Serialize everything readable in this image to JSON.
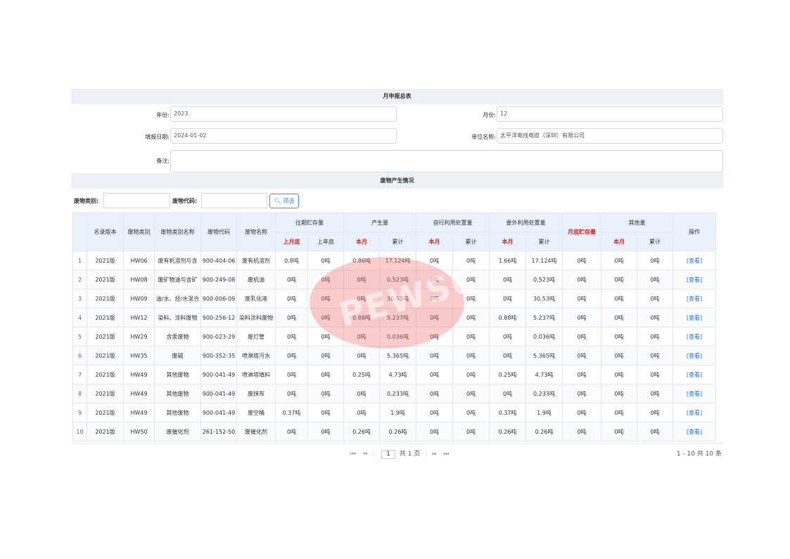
{
  "report": {
    "title": "月申报总表",
    "year_label": "年份:",
    "year_value": "2023",
    "month_label": "月份:",
    "month_value": "12",
    "fill_date_label": "填报日期:",
    "fill_date_value": "2024-01-02",
    "company_label": "单位名称:",
    "company_value": "太平洋电线电缆（深圳）有限公司",
    "remark_label": "备注:",
    "remark_value": ""
  },
  "waste_section": {
    "title": "废物产生情况",
    "filter_category_label": "废物类别:",
    "filter_code_label": "废物代码:",
    "filter_button": "筛选",
    "filter_icon": "search-icon"
  },
  "table": {
    "headers": {
      "version": "名录版本",
      "category": "废物类别",
      "category_name": "废物类别名称",
      "code": "废物代码",
      "name": "废物名称",
      "past_storage": "往期贮存量",
      "past_last_month": "上月底",
      "past_last_year": "上年底",
      "produced": "产生量",
      "produced_month": "本月",
      "produced_total": "累计",
      "self_use": "自行利用处置量",
      "self_month": "本月",
      "self_total": "累计",
      "outsource": "委外利用处置量",
      "out_month": "本月",
      "out_total": "累计",
      "month_end_storage": "月底贮存量",
      "other": "其他量",
      "other_month": "本月",
      "other_total": "累计",
      "action": "操作"
    },
    "rows": [
      {
        "idx": "1",
        "version": "2021版",
        "category": "HW06",
        "category_name": "废有机溶剂与含",
        "code": "900-404-06",
        "name": "废有机溶剂",
        "past_month": "0.8吨",
        "past_year": "0吨",
        "prod_month": "0.86吨",
        "prod_total": "17.124吨",
        "self_month": "0吨",
        "self_total": "0吨",
        "out_month": "1.66吨",
        "out_total": "17.124吨",
        "end_storage": "0吨",
        "other_month": "0吨",
        "other_total": "0吨",
        "action": "[查看]"
      },
      {
        "idx": "2",
        "version": "2021版",
        "category": "HW08",
        "category_name": "废矿物油与含矿",
        "code": "900-249-08",
        "name": "废机油",
        "past_month": "0吨",
        "past_year": "0吨",
        "prod_month": "0吨",
        "prod_total": "0.523吨",
        "self_month": "0吨",
        "self_total": "0吨",
        "out_month": "0吨",
        "out_total": "0.523吨",
        "end_storage": "0吨",
        "other_month": "0吨",
        "other_total": "0吨",
        "action": "[查看]"
      },
      {
        "idx": "3",
        "version": "2021版",
        "category": "HW09",
        "category_name": "油/水、烃/水混合",
        "code": "900-006-09",
        "name": "废乳化液",
        "past_month": "0吨",
        "past_year": "0吨",
        "prod_month": "0吨",
        "prod_total": "30.53吨",
        "self_month": "0吨",
        "self_total": "0吨",
        "out_month": "0吨",
        "out_total": "30.53吨",
        "end_storage": "0吨",
        "other_month": "0吨",
        "other_total": "0吨",
        "action": "[查看]"
      },
      {
        "idx": "4",
        "version": "2021版",
        "category": "HW12",
        "category_name": "染料、涂料废物",
        "code": "900-256-12",
        "name": "染料涂料废物",
        "past_month": "0吨",
        "past_year": "0吨",
        "prod_month": "0.88吨",
        "prod_total": "5.237吨",
        "self_month": "0吨",
        "self_total": "0吨",
        "out_month": "0.88吨",
        "out_total": "5.237吨",
        "end_storage": "0吨",
        "other_month": "0吨",
        "other_total": "0吨",
        "action": "[查看]"
      },
      {
        "idx": "5",
        "version": "2021版",
        "category": "HW29",
        "category_name": "含汞废物",
        "code": "900-023-29",
        "name": "废灯管",
        "past_month": "0吨",
        "past_year": "0吨",
        "prod_month": "0吨",
        "prod_total": "0.036吨",
        "self_month": "0吨",
        "self_total": "0吨",
        "out_month": "0吨",
        "out_total": "0.036吨",
        "end_storage": "0吨",
        "other_month": "0吨",
        "other_total": "0吨",
        "action": "[查看]"
      },
      {
        "idx": "6",
        "version": "2021版",
        "category": "HW35",
        "category_name": "废碱",
        "code": "900-352-35",
        "name": "喷淋塔污水",
        "past_month": "0吨",
        "past_year": "0吨",
        "prod_month": "0吨",
        "prod_total": "5.365吨",
        "self_month": "0吨",
        "self_total": "0吨",
        "out_month": "0吨",
        "out_total": "5.365吨",
        "end_storage": "0吨",
        "other_month": "0吨",
        "other_total": "0吨",
        "action": "[查看]"
      },
      {
        "idx": "7",
        "version": "2021版",
        "category": "HW49",
        "category_name": "其他废物",
        "code": "900-041-49",
        "name": "喷淋塔填料",
        "past_month": "0吨",
        "past_year": "0吨",
        "prod_month": "0.25吨",
        "prod_total": "4.73吨",
        "self_month": "0吨",
        "self_total": "0吨",
        "out_month": "0.25吨",
        "out_total": "4.73吨",
        "end_storage": "0吨",
        "other_month": "0吨",
        "other_total": "0吨",
        "action": "[查看]"
      },
      {
        "idx": "8",
        "version": "2021版",
        "category": "HW49",
        "category_name": "其他废物",
        "code": "900-041-49",
        "name": "废抹布",
        "past_month": "0吨",
        "past_year": "0吨",
        "prod_month": "0吨",
        "prod_total": "0.233吨",
        "self_month": "0吨",
        "self_total": "0吨",
        "out_month": "0吨",
        "out_total": "0.233吨",
        "end_storage": "0吨",
        "other_month": "0吨",
        "other_total": "0吨",
        "action": "[查看]"
      },
      {
        "idx": "9",
        "version": "2021版",
        "category": "HW49",
        "category_name": "其他废物",
        "code": "900-041-49",
        "name": "废空桶",
        "past_month": "0.37吨",
        "past_year": "0吨",
        "prod_month": "0吨",
        "prod_total": "1.9吨",
        "self_month": "0吨",
        "self_total": "0吨",
        "out_month": "0.37吨",
        "out_total": "1.9吨",
        "end_storage": "0吨",
        "other_month": "0吨",
        "other_total": "0吨",
        "action": "[查看]"
      },
      {
        "idx": "10",
        "version": "2021版",
        "category": "HW50",
        "category_name": "废催化剂",
        "code": "261-152-50",
        "name": "废催化剂",
        "past_month": "0吨",
        "past_year": "0吨",
        "prod_month": "0.26吨",
        "prod_total": "0.26吨",
        "self_month": "0吨",
        "self_total": "0吨",
        "out_month": "0.26吨",
        "out_total": "0.26吨",
        "end_storage": "0吨",
        "other_month": "0吨",
        "other_total": "0吨",
        "action": "[查看]"
      }
    ]
  },
  "pager": {
    "first_icon": "first-page-icon",
    "prev_icon": "prev-page-icon",
    "page_value": "1",
    "total_pages": "共 1 页",
    "next_icon": "next-page-icon",
    "last_icon": "last-page-icon",
    "summary": "1 - 10  共 10 条"
  },
  "watermark": {
    "text": "PEWSC",
    "color": "#f06e6e"
  }
}
